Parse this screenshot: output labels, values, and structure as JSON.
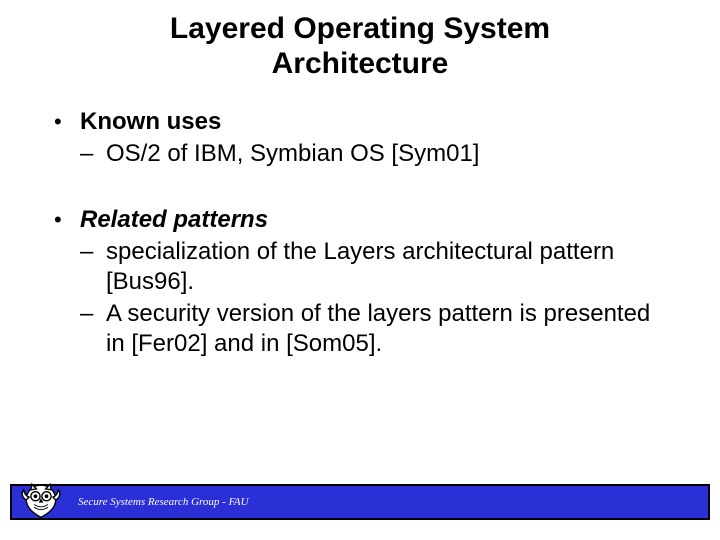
{
  "title_line1": "Layered Operating System",
  "title_line2": "Architecture",
  "section1": {
    "heading": "Known uses",
    "items": [
      "OS/2 of IBM, Symbian OS [Sym01]"
    ]
  },
  "section2": {
    "heading": "Related patterns",
    "items": [
      "specialization of the Layers architectural pattern [Bus96].",
      "A security version of the layers pattern is presented in [Fer02] and in [Som05]."
    ]
  },
  "footer": {
    "text": "Secure Systems Research Group - FAU",
    "icon": "owl-logo"
  }
}
